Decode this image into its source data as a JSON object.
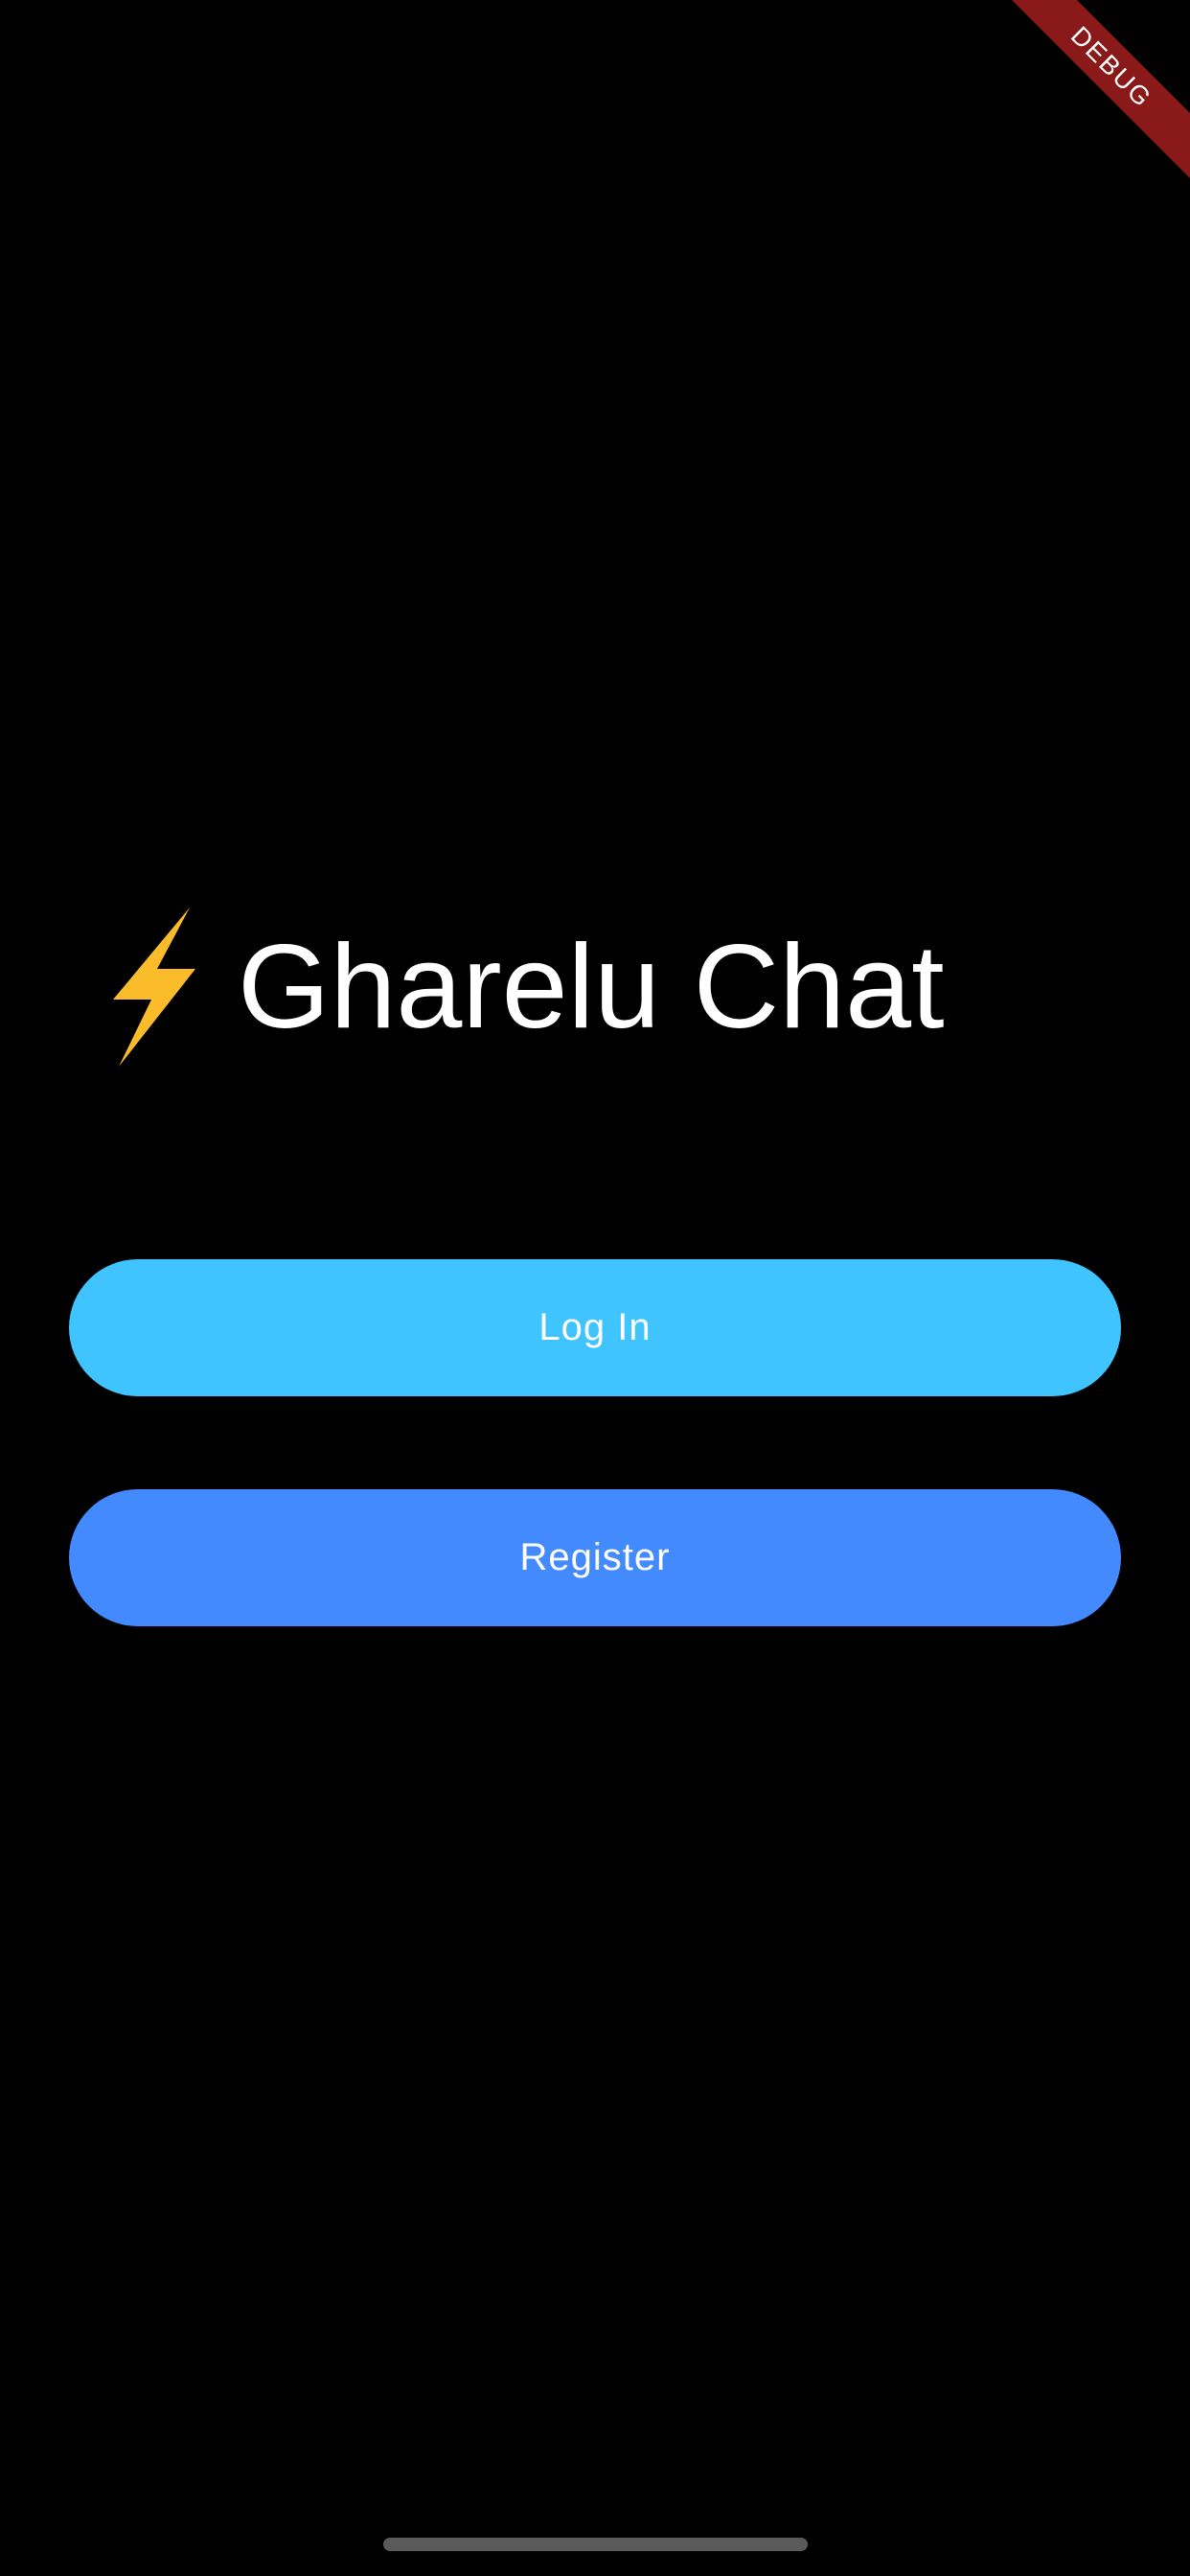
{
  "debug_banner": {
    "label": "DEBUG",
    "color": "#8a1a1a"
  },
  "brand": {
    "icon": "lightning-bolt-icon",
    "icon_color": "#fbbc2c",
    "title": "Gharelu Chat"
  },
  "buttons": {
    "login": {
      "label": "Log In",
      "color": "#40c4ff"
    },
    "register": {
      "label": "Register",
      "color": "#448aff"
    }
  },
  "background_color": "#000000"
}
